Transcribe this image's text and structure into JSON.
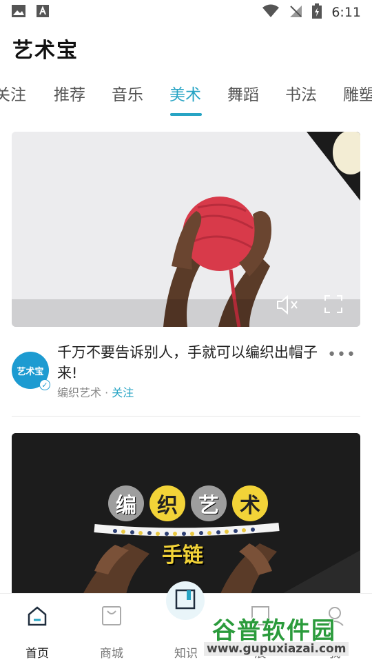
{
  "status_bar": {
    "time": "6:11"
  },
  "app": {
    "title": "艺术宝"
  },
  "tabs": [
    {
      "label": "关注",
      "active": false
    },
    {
      "label": "推荐",
      "active": false
    },
    {
      "label": "音乐",
      "active": false
    },
    {
      "label": "美术",
      "active": true
    },
    {
      "label": "舞蹈",
      "active": false
    },
    {
      "label": "书法",
      "active": false
    },
    {
      "label": "雕塑",
      "active": false
    }
  ],
  "feed": {
    "post1": {
      "title": "千万不要告诉别人，手就可以编织出帽子来!",
      "author": "编织艺术",
      "separator": "·",
      "follow_label": "关注",
      "avatar_text": "艺术宝"
    },
    "post2": {
      "overlay_chars": [
        "编",
        "织",
        "艺",
        "术"
      ],
      "overlay_sub": "手链"
    }
  },
  "bottom_nav": [
    {
      "label": "首页",
      "icon": "home-icon",
      "active": true
    },
    {
      "label": "商城",
      "icon": "shop-bag-icon",
      "active": false
    },
    {
      "label": "知识",
      "icon": "book-icon",
      "active": false
    },
    {
      "label": "展",
      "icon": "exhibit-icon",
      "active": false
    },
    {
      "label": "我",
      "icon": "profile-icon",
      "active": false
    }
  ],
  "watermark": {
    "main": "谷普软件园",
    "url": "www.gupuxiazai.com"
  },
  "colors": {
    "accent": "#27a4c4",
    "avatar": "#1d9bd1",
    "yarn": "#d83a4a"
  }
}
